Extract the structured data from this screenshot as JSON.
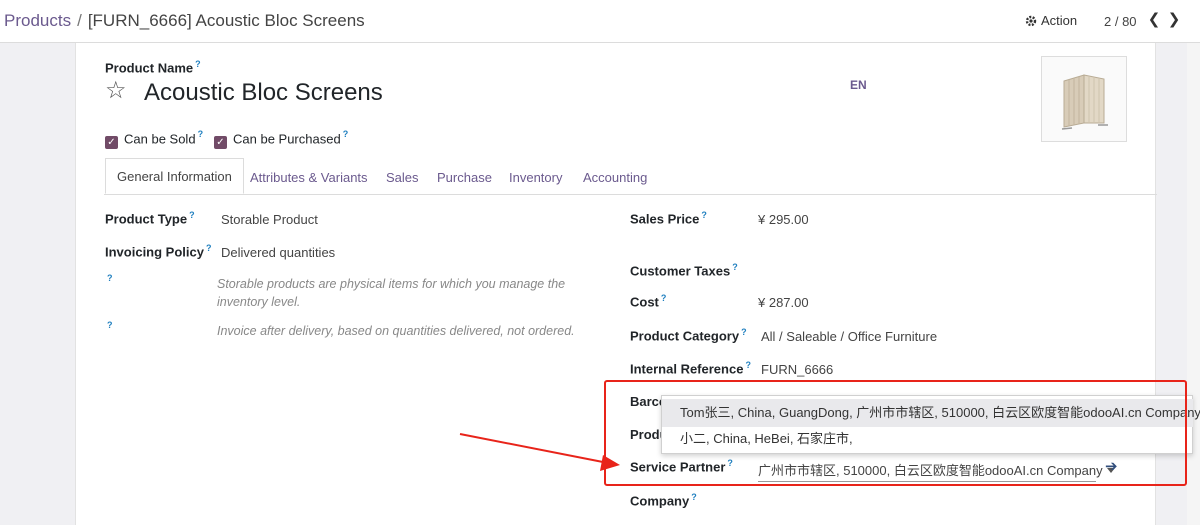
{
  "breadcrumb": {
    "parent": "Products",
    "separator": "/",
    "current": "[FURN_6666] Acoustic Bloc Screens"
  },
  "toolbar": {
    "action_label": "Action",
    "pager": "2 / 80",
    "prev_icon": "chevron-left",
    "next_icon": "chevron-right"
  },
  "product": {
    "name_label": "Product Name",
    "help_mark": "?",
    "name": "Acoustic Bloc Screens",
    "lang": "EN",
    "can_be_sold_label": "Can be Sold",
    "can_be_purchased_label": "Can be Purchased"
  },
  "tabs": [
    "General Information",
    "Attributes & Variants",
    "Sales",
    "Purchase",
    "Inventory",
    "Accounting"
  ],
  "left": {
    "product_type_label": "Product Type",
    "product_type_value": "Storable Product",
    "invoicing_policy_label": "Invoicing Policy",
    "invoicing_policy_value": "Delivered quantities",
    "help1": "Storable products are physical items for which you manage the inventory level.",
    "help2": "Invoice after delivery, based on quantities delivered, not ordered."
  },
  "right": {
    "sales_price_label": "Sales Price",
    "sales_price_value": "¥ 295.00",
    "customer_taxes_label": "Customer Taxes",
    "cost_label": "Cost",
    "cost_value": "¥ 287.00",
    "category_label": "Product Category",
    "category_value": "All / Saleable / Office Furniture",
    "internal_ref_label": "Internal Reference",
    "internal_ref_value": "FURN_6666",
    "barcode_label_partial": "Barco",
    "product_label_partial": "Produ",
    "service_partner_label": "Service Partner",
    "service_partner_value": "广州市市辖区, 510000, 白云区欧度智能odooAI.cn Company",
    "company_label": "Company"
  },
  "dropdown": {
    "items": [
      "Tom张三, China, GuangDong, 广州市市辖区, 510000, 白云区欧度智能odooAI.cn Company",
      "小二, China, HeBei, 石家庄市,"
    ]
  },
  "colors": {
    "accent": "#714b67",
    "link": "#6b5a8e",
    "annotation": "#e8241a"
  }
}
